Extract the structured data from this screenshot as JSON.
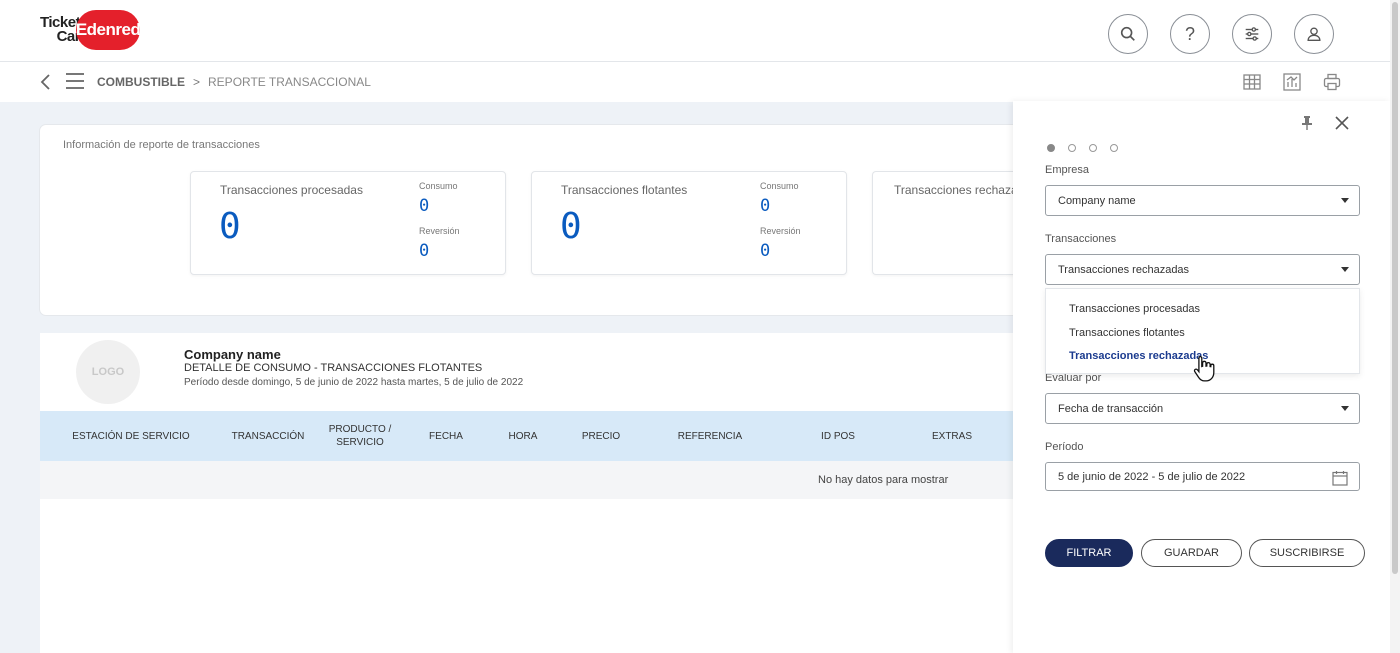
{
  "brand": {
    "ticket": "Ticket",
    "car": "Car",
    "edenred": "Edenred",
    "accent": "#e4202b"
  },
  "header": {
    "icons": [
      "search-icon",
      "help-icon",
      "settings-sliders-icon",
      "user-icon"
    ],
    "help_glyph": "?"
  },
  "breadcrumb": {
    "section": "COMBUSTIBLE",
    "separator": ">",
    "page": "REPORTE TRANSACCIONAL"
  },
  "view_icons": [
    "table-icon",
    "chart-icon",
    "print-icon"
  ],
  "info": {
    "title": "Información de reporte de transacciones",
    "cards": [
      {
        "name": "Transacciones procesadas",
        "total": "0",
        "consumo_label": "Consumo",
        "consumo": "0",
        "reversion_label": "Reversión",
        "reversion": "0"
      },
      {
        "name": "Transacciones flotantes",
        "total": "0",
        "consumo_label": "Consumo",
        "consumo": "0",
        "reversion_label": "Reversión",
        "reversion": "0"
      },
      {
        "name": "Transacciones rechazadas"
      }
    ]
  },
  "detail": {
    "logo_text": "LOGO",
    "company": "Company name",
    "subtitle": "DETALLE DE CONSUMO - TRANSACCIONES FLOTANTES",
    "period": "Período desde domingo, 5 de junio de 2022 hasta martes, 5 de julio de 2022",
    "columns": [
      "ESTACIÓN DE SERVICIO",
      "TRANSACCIÓN",
      "PRODUCTO / SERVICIO",
      "FECHA",
      "HORA",
      "PRECIO",
      "REFERENCIA",
      "ID POS",
      "EXTRAS"
    ],
    "empty": "No hay datos para mostrar"
  },
  "filter": {
    "empresa_label": "Empresa",
    "empresa_value": "Company name",
    "transacciones_label": "Transacciones",
    "transacciones_value": "Transacciones rechazadas",
    "options": [
      "Transacciones procesadas",
      "Transacciones flotantes",
      "Transacciones rechazadas"
    ],
    "evaluar_label": "Evaluar por",
    "evaluar_value": "Fecha de transacción",
    "periodo_label": "Período",
    "periodo_value": "5 de junio de 2022 - 5 de julio de 2022",
    "buttons": {
      "filtrar": "FILTRAR",
      "guardar": "GUARDAR",
      "suscribirse": "SUSCRIBIRSE"
    }
  }
}
